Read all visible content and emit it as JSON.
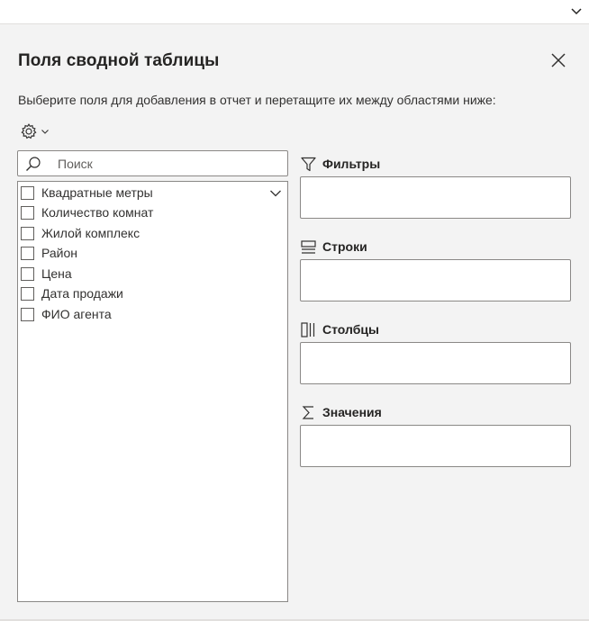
{
  "pane": {
    "title": "Поля сводной таблицы",
    "instructions": "Выберите поля для добавления в отчет и перетащите их между областями ниже:",
    "settings_icon": "gear-icon",
    "close_icon": "close-icon"
  },
  "search": {
    "placeholder": "Поиск",
    "value": ""
  },
  "fields": [
    {
      "label": "Квадратные метры",
      "checked": false
    },
    {
      "label": "Количество комнат",
      "checked": false
    },
    {
      "label": "Жилой комплекс",
      "checked": false
    },
    {
      "label": "Район",
      "checked": false
    },
    {
      "label": "Цена",
      "checked": false
    },
    {
      "label": "Дата продажи",
      "checked": false
    },
    {
      "label": "ФИО агента",
      "checked": false
    }
  ],
  "areas": {
    "filters": {
      "label": "Фильтры",
      "icon": "filter-icon"
    },
    "rows": {
      "label": "Строки",
      "icon": "rows-icon"
    },
    "columns": {
      "label": "Столбцы",
      "icon": "columns-icon"
    },
    "values": {
      "label": "Значения",
      "icon": "sigma-icon"
    }
  },
  "colors": {
    "background": "#f3f3f3",
    "border": "#8a8886",
    "text": "#323130"
  }
}
